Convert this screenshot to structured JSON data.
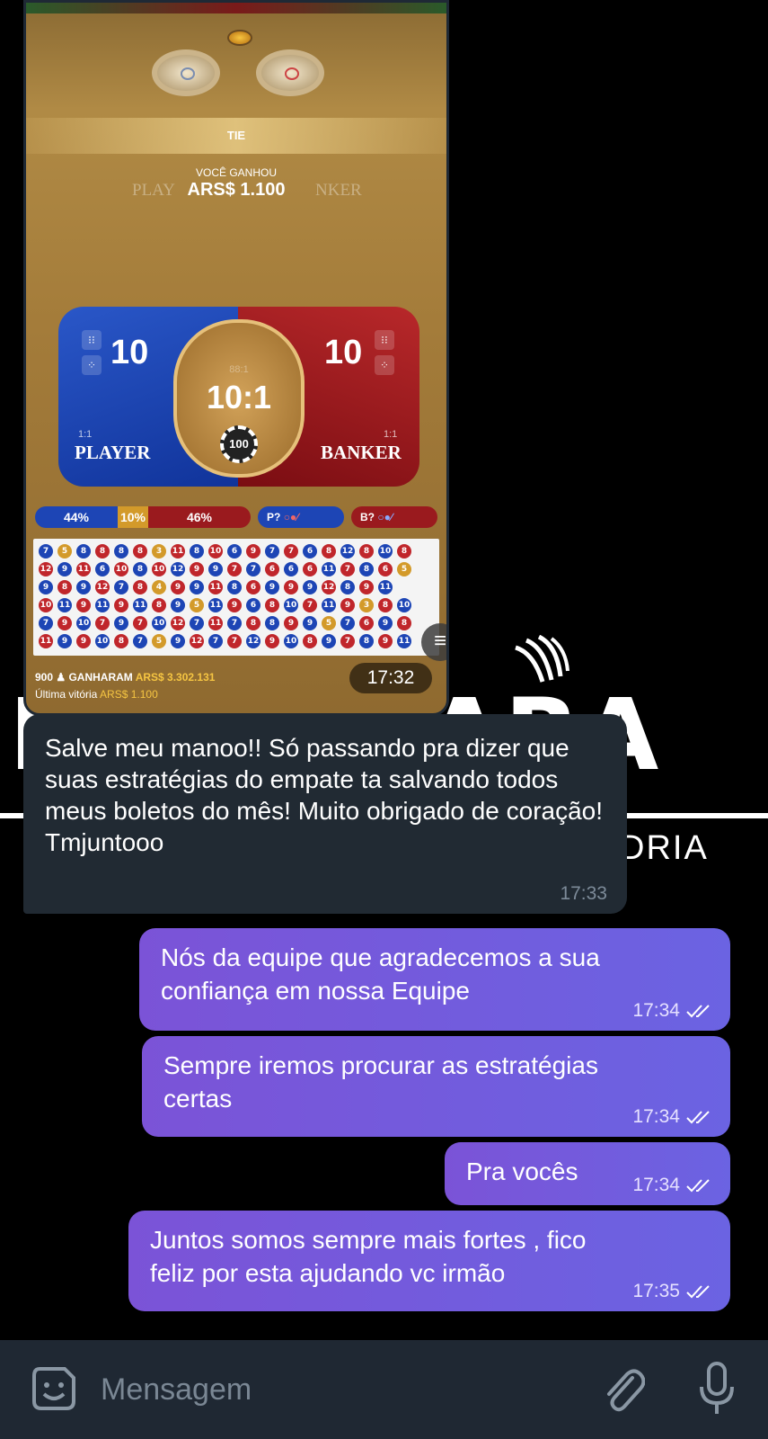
{
  "watermark": {
    "title": "MANAUARA",
    "subtitle": "DRIA",
    "icon": "claw-marks-icon"
  },
  "photo": {
    "game": {
      "result_label": "TIE",
      "won_label": "VOCÊ GANHOU",
      "won_amount": "ARS$ 1.100",
      "faint_left": "PLAY",
      "faint_right": "NKER",
      "player": {
        "score": "10",
        "ratio": "1:1",
        "name": "PLAYER"
      },
      "banker": {
        "score": "10",
        "ratio": "1:1",
        "name": "BANKER"
      },
      "tie": {
        "small_odds": "88:1",
        "odds": "10:1"
      },
      "chip_value": "100",
      "stats": {
        "player_pct": "44%",
        "tie_pct": "10%",
        "banker_pct": "46%"
      },
      "predict_player": "P?",
      "predict_banker": "B?",
      "winners_count": "900",
      "winners_label": "GANHARAM",
      "winners_amount": "ARS$ 3.302.131",
      "last_win_label": "Última vitória",
      "last_win_amount": "ARS$ 1.100",
      "bead_rows": [
        [
          "7",
          "5",
          "8",
          "8",
          "8",
          "8",
          "3",
          "11",
          "8",
          "10",
          "6",
          "9",
          "7",
          "7",
          "6",
          "8",
          "12",
          "8",
          "10",
          "8"
        ],
        [
          "12",
          "9",
          "11",
          "6",
          "10",
          "8",
          "10",
          "12",
          "9",
          "9",
          "7",
          "7",
          "6",
          "6",
          "6",
          "11",
          "7",
          "8",
          "6",
          "5"
        ],
        [
          "9",
          "8",
          "9",
          "12",
          "7",
          "8",
          "4",
          "9",
          "9",
          "11",
          "8",
          "6",
          "9",
          "9",
          "9",
          "12",
          "8",
          "9",
          "11",
          ""
        ],
        [
          "10",
          "11",
          "9",
          "11",
          "9",
          "11",
          "8",
          "9",
          "5",
          "11",
          "9",
          "6",
          "8",
          "10",
          "7",
          "11",
          "9",
          "3",
          "8",
          "10"
        ],
        [
          "7",
          "9",
          "10",
          "7",
          "9",
          "7",
          "10",
          "12",
          "7",
          "11",
          "7",
          "8",
          "8",
          "9",
          "9",
          "5",
          "7",
          "6",
          "9",
          "8"
        ],
        [
          "11",
          "9",
          "9",
          "10",
          "8",
          "7",
          "5",
          "9",
          "12",
          "7",
          "7",
          "12",
          "9",
          "10",
          "8",
          "9",
          "7",
          "8",
          "9",
          "11"
        ]
      ]
    },
    "time": "17:32"
  },
  "messages": [
    {
      "direction": "in",
      "text": "Salve meu manoo!! Só passando pra dizer que suas estratégias do empate ta salvando todos meus boletos do mês! Muito obrigado de coração! Tmjuntooo",
      "time": "17:33"
    },
    {
      "direction": "out",
      "lines": [
        "Nós da equipe que agradecemos a sua",
        "confiança em nossa Equipe"
      ],
      "time": "17:34"
    },
    {
      "direction": "out",
      "lines": [
        "Sempre iremos procurar as estratégias",
        "certas"
      ],
      "time": "17:34"
    },
    {
      "direction": "out",
      "lines": [
        "Pra vocês"
      ],
      "time": "17:34"
    },
    {
      "direction": "out",
      "lines": [
        "Juntos somos sempre mais fortes , fico",
        "feliz por esta ajudando vc irmão"
      ],
      "time": "17:35"
    }
  ],
  "input": {
    "placeholder": "Mensagem",
    "emoji_icon": "sticker-emoji-icon",
    "attach_icon": "paperclip-icon",
    "mic_icon": "microphone-icon"
  },
  "colors": {
    "background": "#000000",
    "incoming_bubble": "#212a33",
    "outgoing_bubble_start": "#7b53d7",
    "outgoing_bubble_end": "#6b63e2",
    "input_bar": "#1f2833",
    "player_blue": "#1d45b5",
    "banker_red": "#9a1a1e",
    "tie_gold": "#d2a259"
  }
}
